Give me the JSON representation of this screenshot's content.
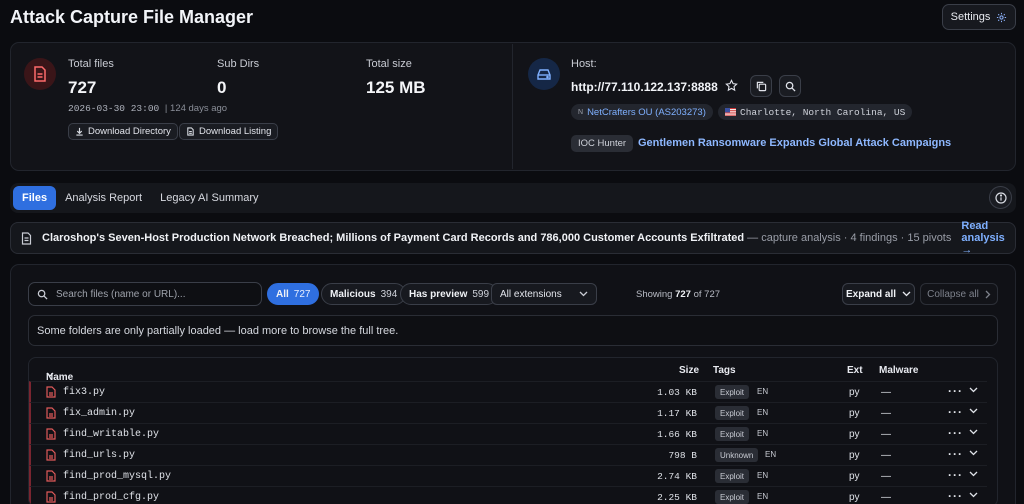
{
  "app": {
    "title": "Attack Capture File Manager",
    "settings_label": "Settings"
  },
  "summary": {
    "total_files_label": "Total files",
    "total_files_value": "727",
    "sub_dirs_label": "Sub Dirs",
    "sub_dirs_value": "0",
    "total_size_label": "Total size",
    "total_size_value": "125 MB",
    "timestamp": "2026-03-30 23:00",
    "age": "124 days ago",
    "download_directory_label": "Download Directory",
    "download_listing_label": "Download Listing"
  },
  "host": {
    "label": "Host:",
    "url": "http://77.110.122.137:8888",
    "asn_prefix": "N",
    "asn": "NetCrafters OU (AS203273)",
    "location": "Charlotte, North Carolina, US",
    "ioc_badge": "IOC Hunter",
    "ioc_title": "Gentlemen Ransomware Expands Global Attack Campaigns"
  },
  "tabs": [
    {
      "label": "Files",
      "active": true
    },
    {
      "label": "Analysis Report",
      "active": false
    },
    {
      "label": "Legacy AI Summary",
      "active": false
    }
  ],
  "banner": {
    "title": "Claroshop's Seven-Host Production Network Breached; Millions of Payment Card Records and 786,000 Customer Accounts Exfiltrated",
    "meta": "— capture analysis · 4 findings · 15 pivots",
    "link": "Read analysis →"
  },
  "filters": {
    "search_placeholder": "Search files (name or URL)...",
    "all_label": "All",
    "all_count": "727",
    "malicious_label": "Malicious",
    "malicious_count": "394",
    "preview_label": "Has preview",
    "preview_count": "599",
    "extensions_label": "All extensions",
    "showing_prefix": "Showing",
    "showing_count": "727",
    "showing_suffix": "of 727",
    "expand_all": "Expand all",
    "collapse_all": "Collapse all"
  },
  "notice": "Some folders are only partially loaded — load more to browse the full tree.",
  "table": {
    "columns": {
      "name": "Name",
      "size": "Size",
      "tags": "Tags",
      "ext": "Ext",
      "malware": "Malware"
    },
    "rows": [
      {
        "name": "fix3.py",
        "size": "1.03 KB",
        "tag": "Exploit",
        "lang": "EN",
        "ext": "py",
        "malware": "—"
      },
      {
        "name": "fix_admin.py",
        "size": "1.17 KB",
        "tag": "Exploit",
        "lang": "EN",
        "ext": "py",
        "malware": "—"
      },
      {
        "name": "find_writable.py",
        "size": "1.66 KB",
        "tag": "Exploit",
        "lang": "EN",
        "ext": "py",
        "malware": "—"
      },
      {
        "name": "find_urls.py",
        "size": "798 B",
        "tag": "Unknown",
        "lang": "EN",
        "ext": "py",
        "malware": "—"
      },
      {
        "name": "find_prod_mysql.py",
        "size": "2.74 KB",
        "tag": "Exploit",
        "lang": "EN",
        "ext": "py",
        "malware": "—"
      },
      {
        "name": "find_prod_cfg.py",
        "size": "2.25 KB",
        "tag": "Exploit",
        "lang": "EN",
        "ext": "py",
        "malware": "—"
      }
    ]
  },
  "colors": {
    "accent": "#2f6fe0",
    "link": "#7fb0ff",
    "danger": "#e05a5a",
    "row_marker": "#7a2530"
  }
}
